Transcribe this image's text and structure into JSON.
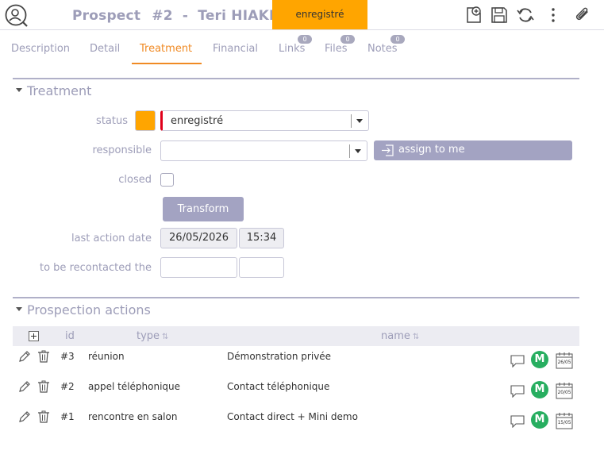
{
  "header": {
    "object": "Prospect",
    "number": "#2",
    "separator": "-",
    "name": "Teri HIAKI",
    "status": "enregistré",
    "status_color": "#ffa500",
    "icons": [
      "search-icon",
      "new-document-icon",
      "save-icon",
      "refresh-icon",
      "more-vertical-icon",
      "attach-icon"
    ]
  },
  "tabs": [
    {
      "label": "Description"
    },
    {
      "label": "Detail"
    },
    {
      "label": "Treatment",
      "active": true
    },
    {
      "label": "Financial"
    },
    {
      "label": "Links",
      "badge": "0"
    },
    {
      "label": "Files",
      "badge": "0"
    },
    {
      "label": "Notes",
      "badge": "0"
    }
  ],
  "treatment": {
    "section_title": "Treatment",
    "status_label": "status",
    "status_value": "enregistré",
    "responsible_label": "responsible",
    "responsible_value": "",
    "assign_label": "assign to me",
    "closed_label": "closed",
    "transform_label": "Transform",
    "last_action_label": "last action date",
    "last_action_date": "26/05/2026",
    "last_action_time": "15:34",
    "recontact_label": "to be recontacted the",
    "recontact_date": "",
    "recontact_time": ""
  },
  "actions": {
    "section_title": "Prospection actions",
    "columns": {
      "id": "id",
      "type": "type",
      "name": "name"
    },
    "sort_glyph": "⇅",
    "rows": [
      {
        "id": "#3",
        "type": "réunion",
        "name": "Démonstration privée",
        "user": "M",
        "date": "26/05"
      },
      {
        "id": "#2",
        "type": "appel téléphonique",
        "name": "Contact téléphonique",
        "user": "M",
        "date": "20/05"
      },
      {
        "id": "#1",
        "type": "rencontre en salon",
        "name": "Contact direct + Mini demo",
        "user": "M",
        "date": "15/05"
      }
    ]
  },
  "colors": {
    "accent": "#f08a24",
    "muted_text": "#9d9db8",
    "button": "#a3a3c2",
    "avatar": "#27ae60"
  }
}
